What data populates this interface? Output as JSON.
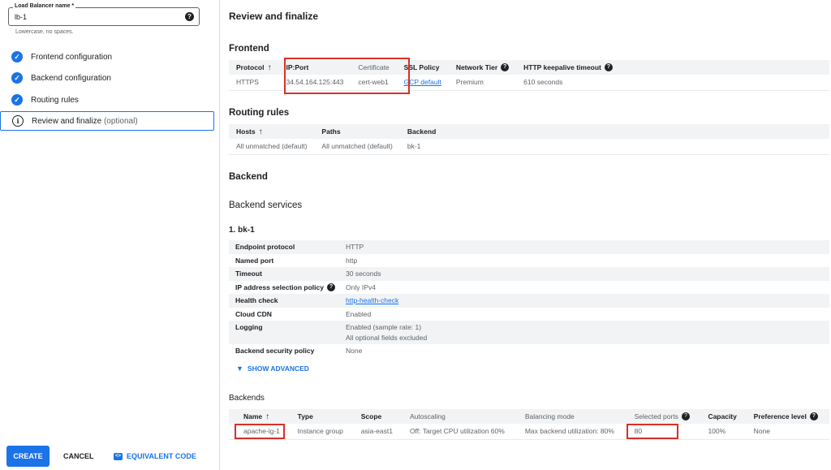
{
  "left": {
    "lb_name": {
      "label": "Load Balancer name *",
      "value": "lb-1",
      "hint": "Lowercase, no spaces.",
      "help": "?"
    },
    "steps": [
      {
        "label": "Frontend configuration",
        "status": "complete",
        "icon": "check-circle-icon"
      },
      {
        "label": "Backend configuration",
        "status": "complete",
        "icon": "check-circle-icon"
      },
      {
        "label": "Routing rules",
        "status": "complete",
        "icon": "check-circle-icon"
      },
      {
        "label": "Review and finalize",
        "optional": "(optional)",
        "status": "active",
        "icon": "info-icon"
      }
    ],
    "buttons": {
      "create": "CREATE",
      "cancel": "CANCEL",
      "equivalent_code": "EQUIVALENT CODE",
      "code_icon": "<>"
    }
  },
  "main": {
    "title": "Review and finalize",
    "frontend": {
      "heading": "Frontend",
      "columns": [
        "Protocol",
        "IP:Port",
        "Certificate",
        "SSL Policy",
        "Network Tier",
        "HTTP keepalive timeout"
      ],
      "sort_arrow": "↑",
      "help": "?",
      "row": [
        "HTTPS",
        "34.54.164.125:443",
        "cert-web1",
        "GCP default",
        "Premium",
        "610 seconds"
      ]
    },
    "routing": {
      "heading": "Routing rules",
      "columns": [
        "Hosts",
        "Paths",
        "Backend"
      ],
      "row": [
        "All unmatched (default)",
        "All unmatched (default)",
        "bk-1"
      ]
    },
    "backend": {
      "heading": "Backend",
      "services_heading": "Backend services",
      "service_title": "1. bk-1",
      "details": [
        {
          "key": "Endpoint protocol",
          "value": "HTTP"
        },
        {
          "key": "Named port",
          "value": "http"
        },
        {
          "key": "Timeout",
          "value": "30 seconds"
        },
        {
          "key": "IP address selection policy",
          "value": "Only IPv4",
          "help": "?"
        },
        {
          "key": "Health check",
          "value": "http-health-check",
          "link": true
        },
        {
          "key": "Cloud CDN",
          "value": "Enabled"
        },
        {
          "key": "Logging",
          "value": "Enabled (sample rate: 1)",
          "value2": "All optional fields excluded"
        },
        {
          "key": "Backend security policy",
          "value": "None"
        }
      ],
      "show_advanced": "SHOW ADVANCED",
      "backends_heading": "Backends",
      "backends_columns": [
        "Name",
        "Type",
        "Scope",
        "Autoscaling",
        "Balancing mode",
        "Selected ports",
        "Capacity",
        "Preference level"
      ],
      "backends_row": [
        "apache-ig-1",
        "Instance group",
        "asia-east1",
        "Off: Target CPU utilization 60%",
        "Max backend utilization: 80%",
        "80",
        "100%",
        "None"
      ]
    }
  },
  "colors": {
    "accent": "#1a73e8",
    "highlight": "#d93025"
  }
}
